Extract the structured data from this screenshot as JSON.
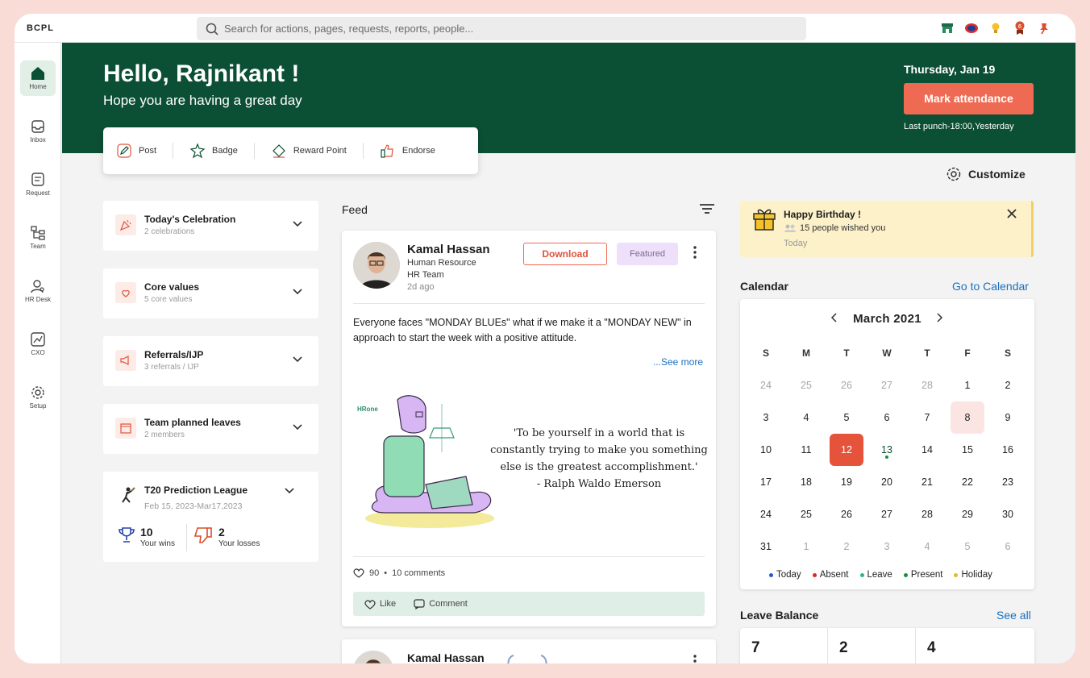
{
  "app": {
    "brand": "BCPL"
  },
  "search": {
    "placeholder": "Search for actions, pages, requests, reports, people..."
  },
  "top_icons": [
    "store-icon",
    "badge-icon",
    "bulb-icon",
    "award-icon",
    "pin-icon"
  ],
  "sidebar": {
    "items": [
      {
        "label": "Home",
        "icon": "home-icon",
        "active": true
      },
      {
        "label": "Inbox",
        "icon": "inbox-icon"
      },
      {
        "label": "Request",
        "icon": "request-icon"
      },
      {
        "label": "Team",
        "icon": "team-icon"
      },
      {
        "label": "HR Desk",
        "icon": "hr-desk-icon"
      },
      {
        "label": "CXO",
        "icon": "cxo-icon"
      },
      {
        "label": "Setup",
        "icon": "setup-icon"
      }
    ]
  },
  "hero": {
    "greeting": "Hello, Rajnikant !",
    "subtitle": "Hope you are having a great day",
    "date": "Thursday, Jan 19",
    "mark_attendance": "Mark attendance",
    "last_punch": "Last punch-18:00,Yesterday"
  },
  "actions": {
    "post": "Post",
    "badge": "Badge",
    "reward": "Reward Point",
    "endorse": "Endorse"
  },
  "customize": "Customize",
  "left_cards": [
    {
      "title": "Today's Celebration",
      "subtitle": "2 celebrations"
    },
    {
      "title": "Core values",
      "subtitle": "5 core values"
    },
    {
      "title": "Referrals/IJP",
      "subtitle": "3 referrals / IJP"
    },
    {
      "title": "Team planned leaves",
      "subtitle": "2 members"
    }
  ],
  "t20": {
    "title": "T20 Prediction League",
    "dates": "Feb 15, 2023-Mar17,2023",
    "wins": "10",
    "wins_label": "Your wins",
    "losses": "2",
    "losses_label": "Your losses"
  },
  "feed": {
    "label": "Feed",
    "post": {
      "name": "Kamal Hassan",
      "dept": "Human Resource",
      "team": "HR Team",
      "time": "2d ago",
      "download": "Download",
      "featured": "Featured",
      "text": "Everyone faces \"MONDAY BLUEs\" what if we make it a \"MONDAY NEW\" in approach to start the week with a positive attitude.",
      "see_more": "...See more",
      "image_brand": "HRone",
      "quote_1": "'To be yourself in a world that is",
      "quote_2": "constantly trying to make you something",
      "quote_3": "else is the greatest accomplishment.'",
      "quote_4": "- Ralph Waldo Emerson",
      "likes": "90",
      "comments": "10 comments",
      "like_label": "Like",
      "comment_label": "Comment"
    },
    "post2": {
      "name": "Kamal Hassan"
    }
  },
  "birthday": {
    "title": "Happy Birthday !",
    "wishes": "15 people wished you",
    "when": "Today"
  },
  "calendar": {
    "heading": "Calendar",
    "link": "Go to Calendar",
    "month": "March  2021",
    "days": [
      "S",
      "M",
      "T",
      "W",
      "T",
      "F",
      "S"
    ],
    "weeks": [
      [
        "24",
        "25",
        "26",
        "27",
        "28",
        "1",
        "2"
      ],
      [
        "3",
        "4",
        "5",
        "6",
        "7",
        "8",
        "9"
      ],
      [
        "10",
        "11",
        "12",
        "13",
        "14",
        "15",
        "16"
      ],
      [
        "17",
        "18",
        "19",
        "20",
        "21",
        "22",
        "23"
      ],
      [
        "24",
        "25",
        "26",
        "27",
        "28",
        "29",
        "30"
      ],
      [
        "31",
        "1",
        "2",
        "3",
        "4",
        "5",
        "6"
      ]
    ],
    "legend": [
      {
        "label": "Today",
        "color": "#1a5fd6"
      },
      {
        "label": "Absent",
        "color": "#e02424"
      },
      {
        "label": "Leave",
        "color": "#2bb39a"
      },
      {
        "label": "Present",
        "color": "#1a8f3a"
      },
      {
        "label": "Holiday",
        "color": "#e8b82a"
      }
    ]
  },
  "leave_balance": {
    "heading": "Leave Balance",
    "link": "See all",
    "values": [
      "7",
      "2",
      "4"
    ]
  },
  "colors": {
    "brand_green": "#0b4f34",
    "accent": "#ef6a52",
    "link": "#1a6fbf"
  }
}
